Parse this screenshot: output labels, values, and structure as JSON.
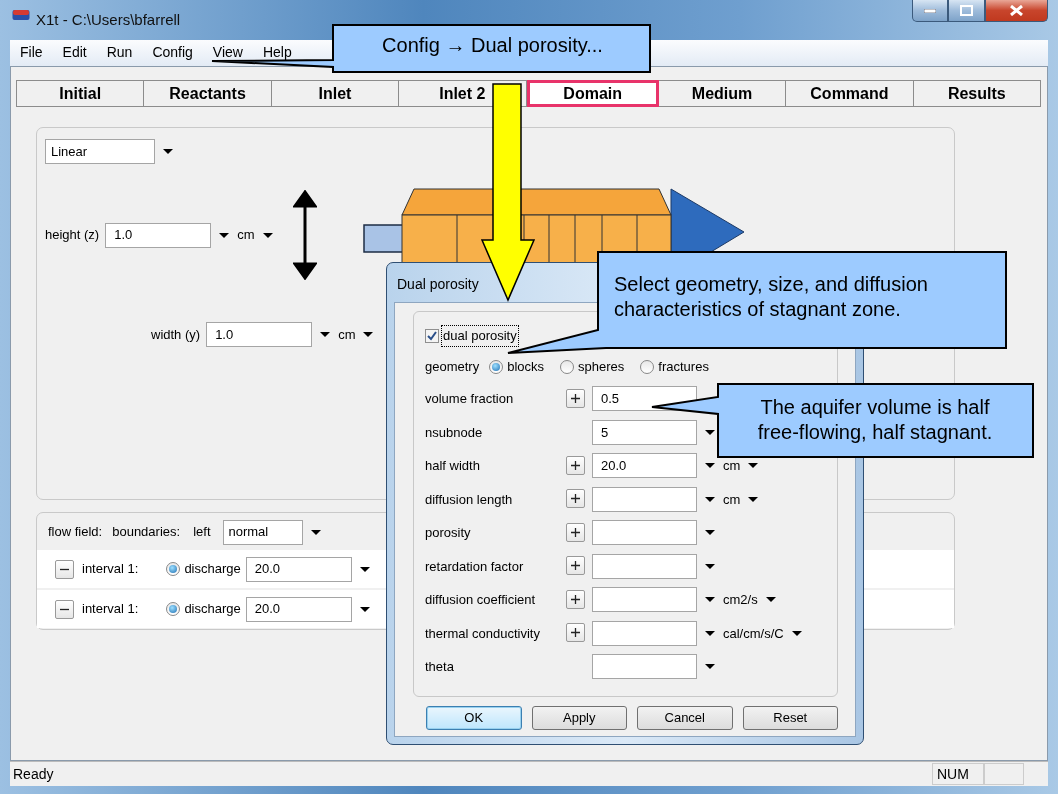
{
  "window": {
    "title": "X1t - C:\\Users\\bfarrell"
  },
  "menu": [
    "File",
    "Edit",
    "Run",
    "Config",
    "View",
    "Help"
  ],
  "tabs": [
    {
      "label": "Initial",
      "selected": false
    },
    {
      "label": "Reactants",
      "selected": false
    },
    {
      "label": "Inlet",
      "selected": false
    },
    {
      "label": "Inlet 2",
      "selected": false
    },
    {
      "label": "Domain",
      "selected": true
    },
    {
      "label": "Medium",
      "selected": false
    },
    {
      "label": "Command",
      "selected": false
    },
    {
      "label": "Results",
      "selected": false
    }
  ],
  "domain": {
    "shape": "Linear",
    "height": {
      "label": "height (z)",
      "value": "1.0",
      "unit": "cm"
    },
    "width": {
      "label": "width (y)",
      "value": "1.0",
      "unit": "cm"
    }
  },
  "flow_field": {
    "label": "flow field:",
    "boundaries_label": "boundaries:",
    "side": "left",
    "boundary": "normal",
    "intervals": [
      {
        "label": "interval 1:",
        "option": "discharge",
        "selected": true,
        "value": "20.0"
      },
      {
        "label": "interval 1:",
        "option": "discharge",
        "selected": true,
        "value": "20.0"
      }
    ]
  },
  "dialog": {
    "title": "Dual porosity",
    "enable": {
      "label": "dual porosity",
      "checked": true,
      "focused": true
    },
    "geometry": {
      "label": "geometry",
      "options": [
        {
          "label": "blocks",
          "selected": true
        },
        {
          "label": "spheres",
          "selected": false
        },
        {
          "label": "fractures",
          "selected": false
        }
      ]
    },
    "fields": [
      {
        "label": "volume fraction",
        "plus": true,
        "value": "0.5",
        "dropdown": false
      },
      {
        "label": "nsubnode",
        "plus": false,
        "value": "5",
        "dropdown": true
      },
      {
        "label": "half width",
        "plus": true,
        "value": "20.0",
        "dropdown": true,
        "unit": "cm"
      },
      {
        "label": "diffusion length",
        "plus": true,
        "dropdown": true,
        "unit": "cm"
      },
      {
        "label": "porosity",
        "plus": true,
        "dropdown": true
      },
      {
        "label": "retardation factor",
        "plus": true,
        "dropdown": true
      },
      {
        "label": "diffusion coefficient",
        "plus": true,
        "dropdown": true,
        "unit": "cm2/s"
      },
      {
        "label": "thermal conductivity",
        "plus": true,
        "dropdown": true,
        "unit": "cal/cm/s/C"
      },
      {
        "label": "theta",
        "plus": false,
        "dropdown": true
      }
    ],
    "buttons": [
      {
        "label": "OK",
        "default": true
      },
      {
        "label": "Apply",
        "default": false
      },
      {
        "label": "Cancel",
        "default": false
      },
      {
        "label": "Reset",
        "default": false
      }
    ]
  },
  "callouts": [
    {
      "text": "Config → Dual porosity..."
    },
    {
      "text": "Select geometry, size, and diffusion characteristics of stagnant zone."
    },
    {
      "text": "The aquifer volume is half free-flowing, half stagnant."
    }
  ],
  "status_bar": {
    "message": "Ready",
    "indicators": [
      "NUM"
    ]
  }
}
